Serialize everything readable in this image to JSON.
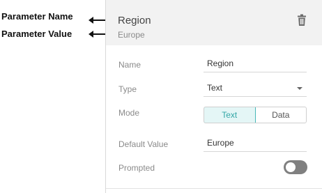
{
  "callouts": {
    "parameter_name": "Parameter Name",
    "parameter_value": "Parameter Value"
  },
  "header": {
    "name": "Region",
    "value": "Europe",
    "delete_icon": "trash-icon"
  },
  "form": {
    "name_label": "Name",
    "name_value": "Region",
    "type_label": "Type",
    "type_value": "Text",
    "mode_label": "Mode",
    "mode_options": [
      "Text",
      "Data"
    ],
    "mode_selected": "Text",
    "default_label": "Default Value",
    "default_value": "Europe",
    "prompted_label": "Prompted",
    "prompted_on": false
  },
  "colors": {
    "accent": "#47b7b7",
    "header_bg": "#f2f2f2",
    "toggle_off": "#808080"
  }
}
